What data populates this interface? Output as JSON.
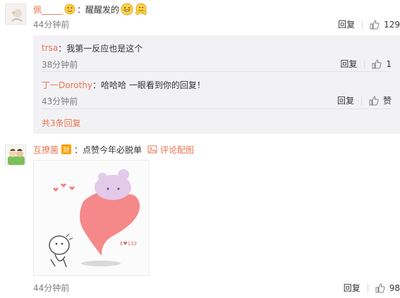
{
  "comments": [
    {
      "username": "佩_____",
      "text": "：醒醒发的",
      "time": "44分钟前",
      "reply_label": "回复",
      "likes": "129"
    },
    {
      "username": "互撩菌",
      "badge": "财",
      "text": "：点赞今年必脱单",
      "view_image_label": "评论配图",
      "time": "44分钟前",
      "reply_label": "回复",
      "likes": "98"
    }
  ],
  "replies": [
    {
      "username": "trsa",
      "text": "：我第一反应也是这个",
      "time": "38分钟前",
      "reply_label": "回复",
      "likes": "1"
    },
    {
      "username": "丁一Dorothy",
      "text": "：哈哈哈 一眼看到你的回复！",
      "time": "43分钟前",
      "reply_label": "回复",
      "likes": "赞"
    }
  ],
  "more_replies": "共3条回复",
  "image_text": "E♥132",
  "colors": {
    "link": "#eb7350",
    "reply_bg": "#f2f2f5",
    "badge": "#ffa000",
    "heart": "#f47b7b"
  },
  "icons": [
    "thumbs-up-icon",
    "image-icon",
    "grin-emoji-icon",
    "hug-emoji-icon",
    "heart-eyes-emoji-icon"
  ]
}
